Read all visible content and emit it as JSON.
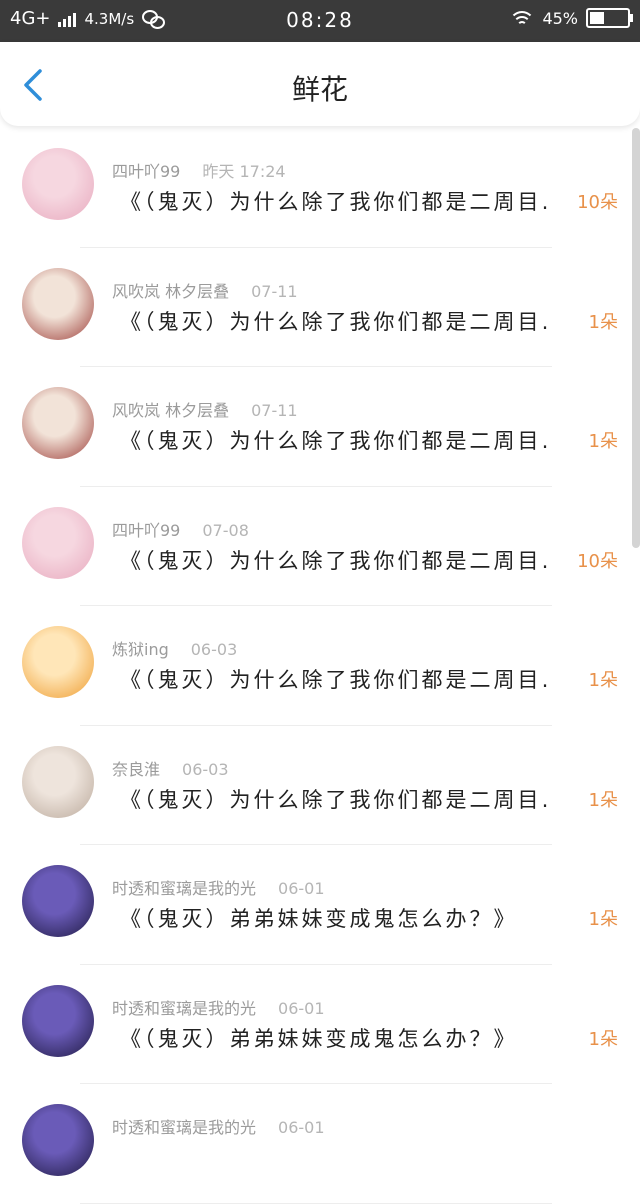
{
  "status_bar": {
    "network": "4G+",
    "speed": "4.3M/s",
    "time": "08:28",
    "battery": "45%",
    "battery_level": 0.45
  },
  "header": {
    "title": "鲜花",
    "back_icon": "chevron-left-icon",
    "accent": "#2f8ed9"
  },
  "rows": [
    {
      "user": "四叶吖99",
      "time": "昨天 17:24",
      "message": "《（鬼灭）为什么除了我你们都是二周目…",
      "flowers": "10朵",
      "avatar_colors": [
        "#f6d7e0",
        "#e7a8bd"
      ]
    },
    {
      "user": "风吹岚 林夕层叠",
      "time": "07-11",
      "message": "《（鬼灭）为什么除了我你们都是二周目…",
      "flowers": "1朵",
      "avatar_colors": [
        "#f2e3d8",
        "#9b3b36"
      ]
    },
    {
      "user": "风吹岚 林夕层叠",
      "time": "07-11",
      "message": "《（鬼灭）为什么除了我你们都是二周目…",
      "flowers": "1朵",
      "avatar_colors": [
        "#f2e3d8",
        "#9b3b36"
      ]
    },
    {
      "user": "四叶吖99",
      "time": "07-08",
      "message": "《（鬼灭）为什么除了我你们都是二周目…",
      "flowers": "10朵",
      "avatar_colors": [
        "#f6d7e0",
        "#e7a8bd"
      ]
    },
    {
      "user": "炼狱ing",
      "time": "06-03",
      "message": "《（鬼灭）为什么除了我你们都是二周目…",
      "flowers": "1朵",
      "avatar_colors": [
        "#ffe6b8",
        "#ee9b2e"
      ]
    },
    {
      "user": "奈良淮",
      "time": "06-03",
      "message": "《（鬼灭）为什么除了我你们都是二周目…",
      "flowers": "1朵",
      "avatar_colors": [
        "#eee4dc",
        "#b9a89a"
      ]
    },
    {
      "user": "时透和蜜璃是我的光",
      "time": "06-01",
      "message": "《（鬼灭）弟弟妹妹变成鬼怎么办？》",
      "flowers": "1朵",
      "avatar_colors": [
        "#6a5bb8",
        "#1d1840"
      ]
    },
    {
      "user": "时透和蜜璃是我的光",
      "time": "06-01",
      "message": "《（鬼灭）弟弟妹妹变成鬼怎么办？》",
      "flowers": "1朵",
      "avatar_colors": [
        "#6a5bb8",
        "#1d1840"
      ]
    },
    {
      "user": "时透和蜜璃是我的光",
      "time": "06-01",
      "message": "",
      "flowers": "",
      "avatar_colors": [
        "#6a5bb8",
        "#1d1840"
      ]
    }
  ]
}
